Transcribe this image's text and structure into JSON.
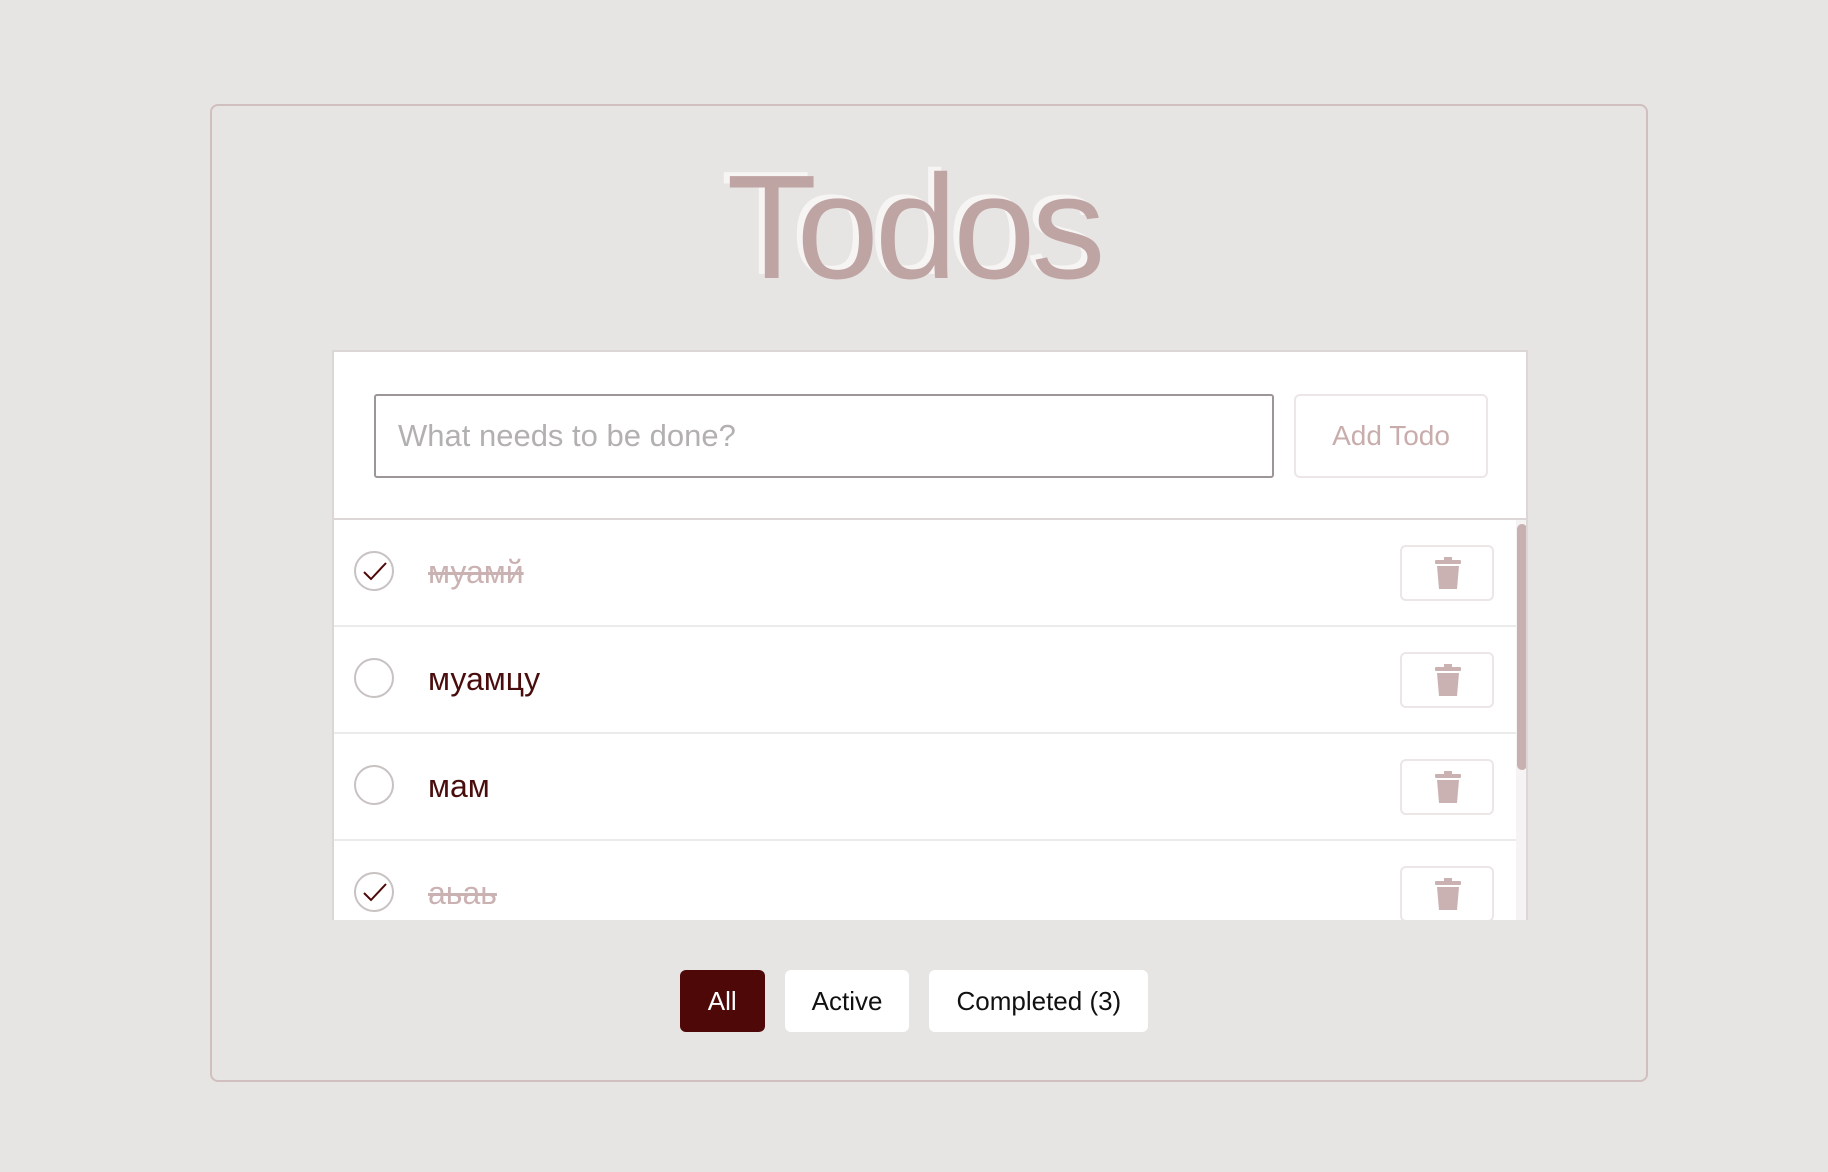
{
  "app": {
    "title": "Todos"
  },
  "new_todo": {
    "placeholder": "What needs to be done?",
    "value": "",
    "add_label": "Add Todo"
  },
  "todos": [
    {
      "text": "муамй",
      "completed": true
    },
    {
      "text": "муамцу",
      "completed": false
    },
    {
      "text": "мам",
      "completed": false
    },
    {
      "text": "аьаь",
      "completed": true
    }
  ],
  "filters": {
    "all": "All",
    "active": "Active",
    "completed": "Completed (3)",
    "selected": "All"
  },
  "colors": {
    "accent": "#4e0808",
    "title": "#bfa4a4",
    "completed_text": "#cbb2b2",
    "active_text": "#4a0d0d"
  },
  "icons": {
    "check": "checkmark-icon",
    "delete": "trash-icon"
  }
}
